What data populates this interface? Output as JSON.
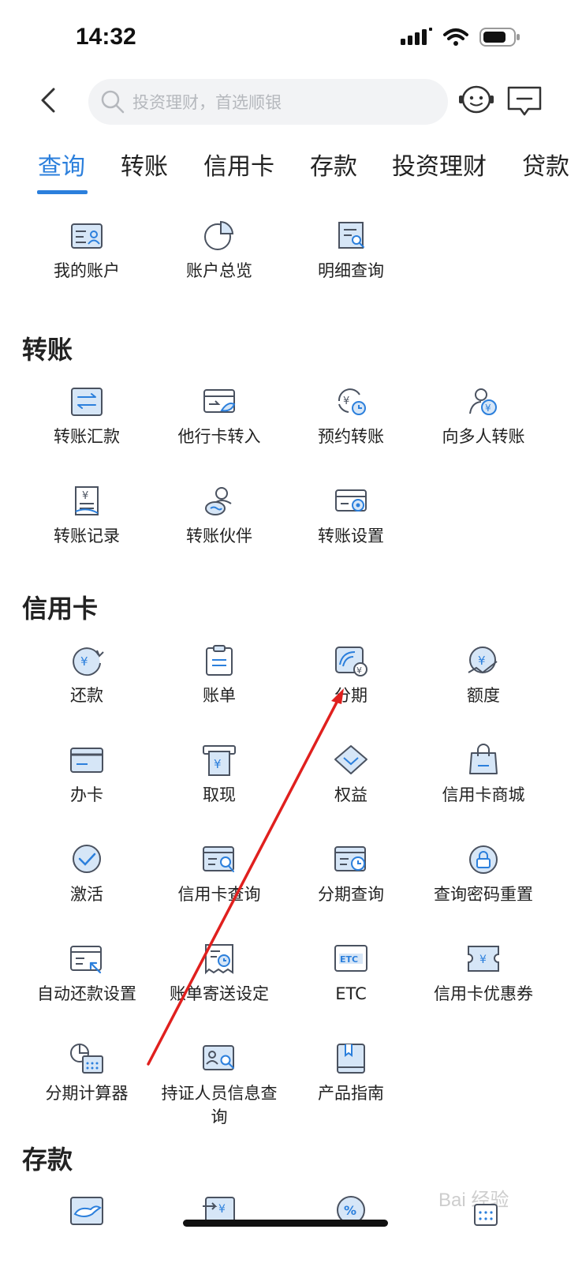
{
  "status_bar": {
    "time": "14:32"
  },
  "search": {
    "placeholder": "投资理财，首选顺银"
  },
  "tabs": [
    {
      "label": "查询",
      "active": true
    },
    {
      "label": "转账"
    },
    {
      "label": "信用卡"
    },
    {
      "label": "存款"
    },
    {
      "label": "投资理财"
    },
    {
      "label": "贷款"
    }
  ],
  "query": {
    "items": [
      {
        "label": "我的账户",
        "icon": "account-icon"
      },
      {
        "label": "账户总览",
        "icon": "pie-chart-icon"
      },
      {
        "label": "明细查询",
        "icon": "detail-search-icon"
      }
    ]
  },
  "transfer": {
    "title": "转账",
    "items": [
      {
        "label": "转账汇款",
        "icon": "transfer-icon"
      },
      {
        "label": "他行卡转入",
        "icon": "card-in-icon"
      },
      {
        "label": "预约转账",
        "icon": "scheduled-transfer-icon"
      },
      {
        "label": "向多人转账",
        "icon": "multi-transfer-icon"
      },
      {
        "label": "转账记录",
        "icon": "record-icon"
      },
      {
        "label": "转账伙伴",
        "icon": "partner-icon"
      },
      {
        "label": "转账设置",
        "icon": "transfer-settings-icon"
      }
    ]
  },
  "credit": {
    "title": "信用卡",
    "items": [
      {
        "label": "还款",
        "icon": "repay-icon"
      },
      {
        "label": "账单",
        "icon": "bill-icon"
      },
      {
        "label": "分期",
        "icon": "installment-icon"
      },
      {
        "label": "额度",
        "icon": "limit-icon"
      },
      {
        "label": "办卡",
        "icon": "apply-card-icon"
      },
      {
        "label": "取现",
        "icon": "cash-icon"
      },
      {
        "label": "权益",
        "icon": "diamond-icon"
      },
      {
        "label": "信用卡商城",
        "icon": "shopping-bag-icon"
      },
      {
        "label": "激活",
        "icon": "activate-icon"
      },
      {
        "label": "信用卡查询",
        "icon": "card-search-icon"
      },
      {
        "label": "分期查询",
        "icon": "installment-search-icon"
      },
      {
        "label": "查询密码重置",
        "icon": "password-reset-icon"
      },
      {
        "label": "自动还款设置",
        "icon": "auto-repay-icon"
      },
      {
        "label": "账单寄送设定",
        "icon": "bill-delivery-icon"
      },
      {
        "label": "ETC",
        "icon": "etc-icon"
      },
      {
        "label": "信用卡优惠券",
        "icon": "coupon-icon"
      },
      {
        "label": "分期计算器",
        "icon": "calculator-icon"
      },
      {
        "label": "持证人员信息查询",
        "icon": "id-search-icon"
      },
      {
        "label": "产品指南",
        "icon": "guide-icon"
      }
    ]
  },
  "deposit": {
    "title": "存款",
    "items": [
      {
        "icon": "whale-icon"
      },
      {
        "icon": "deposit-in-icon"
      },
      {
        "icon": "percent-icon"
      }
    ]
  },
  "watermark": {
    "text": "Bai 经验"
  },
  "colors": {
    "accent": "#2b7fdc",
    "icon_stroke": "#4a5260",
    "icon_fill": "#d6e6f7",
    "arrow": "#e0201e"
  }
}
